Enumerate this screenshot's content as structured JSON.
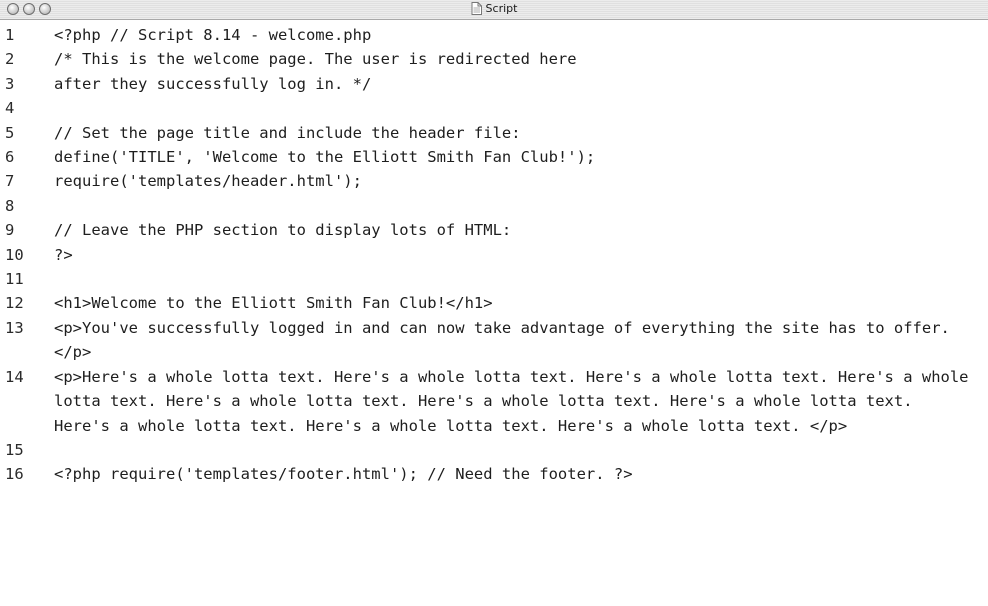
{
  "window": {
    "title": "Script",
    "title_icon": "document-icon",
    "controls": [
      "close-button",
      "minimize-button",
      "zoom-button"
    ]
  },
  "code": {
    "lines": [
      {
        "num": "1",
        "text": "<?php // Script 8.14 - welcome.php"
      },
      {
        "num": "2",
        "text": "/* This is the welcome page. The user is redirected here"
      },
      {
        "num": "3",
        "text": "after they successfully log in. */"
      },
      {
        "num": "4",
        "text": ""
      },
      {
        "num": "5",
        "text": "// Set the page title and include the header file:"
      },
      {
        "num": "6",
        "text": "define('TITLE', 'Welcome to the Elliott Smith Fan Club!');"
      },
      {
        "num": "7",
        "text": "require('templates/header.html');"
      },
      {
        "num": "8",
        "text": ""
      },
      {
        "num": "9",
        "text": "// Leave the PHP section to display lots of HTML:"
      },
      {
        "num": "10",
        "text": "?>"
      },
      {
        "num": "11",
        "text": ""
      },
      {
        "num": "12",
        "text": "<h1>Welcome to the Elliott Smith Fan Club!</h1>"
      },
      {
        "num": "13",
        "text": "<p>You've successfully logged in and can now take advantage of everything the site has to offer.</p>"
      },
      {
        "num": "14",
        "text": "<p>Here's a whole lotta text. Here's a whole lotta text. Here's a whole lotta text. Here's a whole lotta text. Here's a whole lotta text. Here's a whole lotta text. Here's a whole lotta text. Here's a whole lotta text. Here's a whole lotta text. Here's a whole lotta text. </p>"
      },
      {
        "num": "15",
        "text": ""
      },
      {
        "num": "16",
        "text": "<?php require('templates/footer.html'); // Need the footer. ?>"
      }
    ]
  }
}
